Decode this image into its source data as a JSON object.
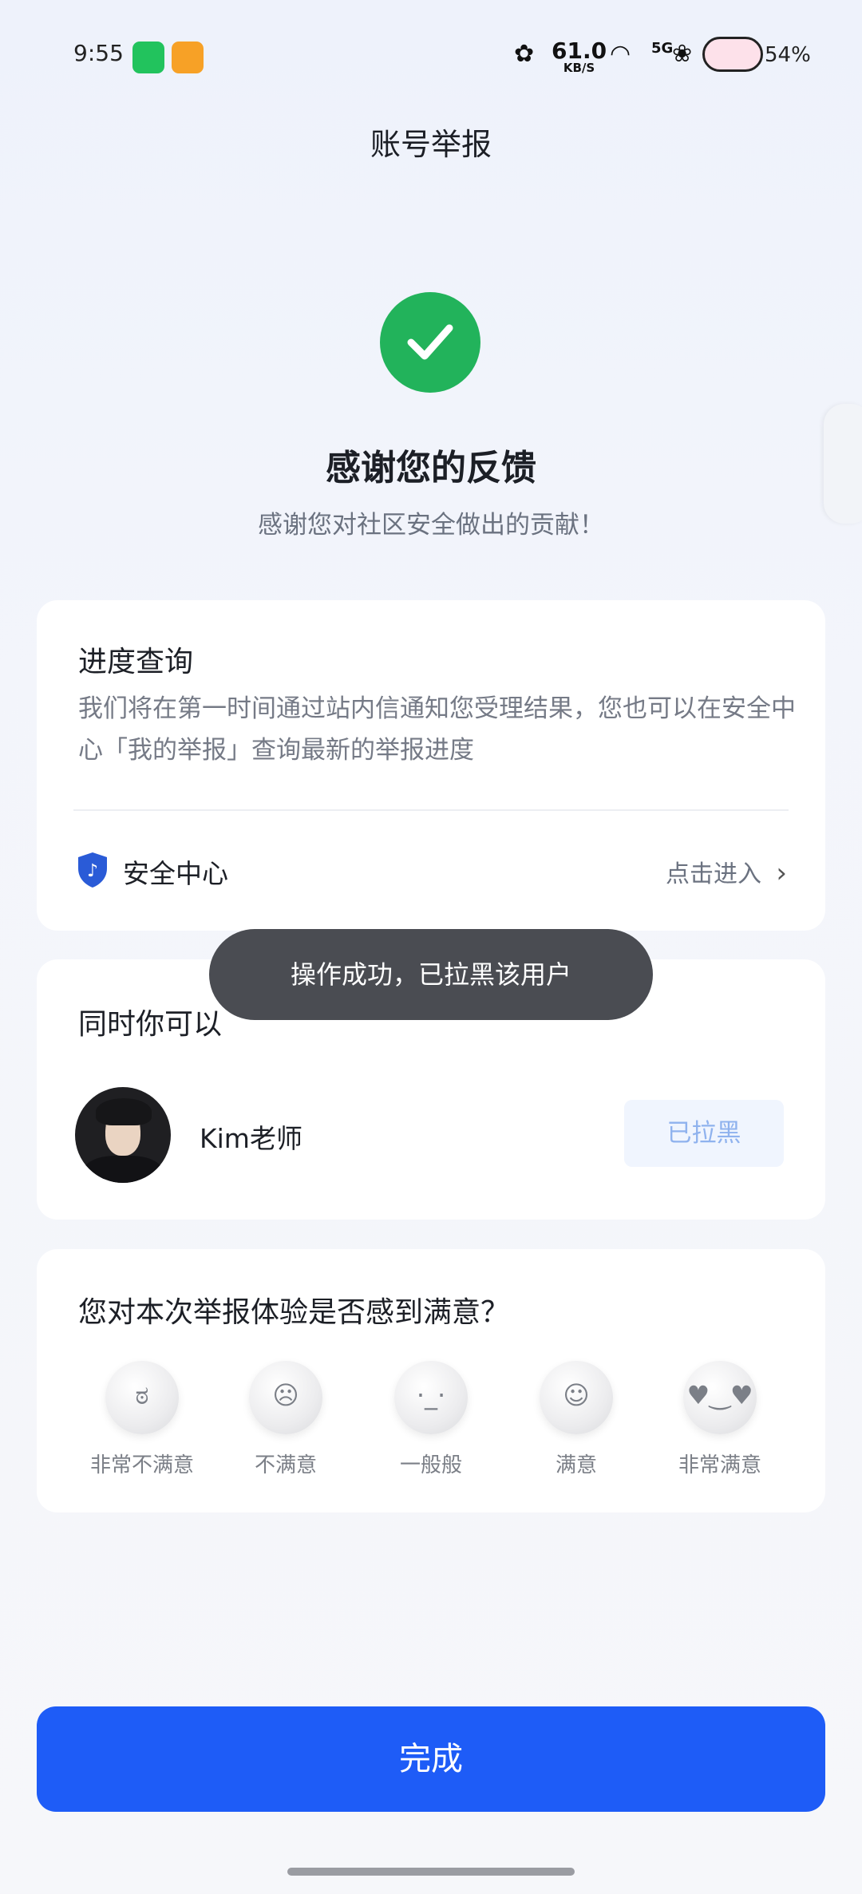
{
  "status_bar": {
    "time": "9:55",
    "speed_value": "61.0",
    "speed_unit": "KB/S",
    "network": "5G",
    "battery": "54%"
  },
  "header": {
    "title": "账号举报"
  },
  "result": {
    "title": "感谢您的反馈",
    "subtitle": "感谢您对社区安全做出的贡献！",
    "icon": "check-circle-icon",
    "color": "#22b35b"
  },
  "progress_card": {
    "title": "进度查询",
    "description": "我们将在第一时间通过站内信通知您受理结果，您也可以在安全中心「我的举报」查询最新的举报进度",
    "security_center_label": "安全中心",
    "enter_label": "点击进入"
  },
  "also_card": {
    "title": "同时你可以",
    "user_name": "Kim老师",
    "blocked_label": "已拉黑"
  },
  "toast": {
    "text": "操作成功，已拉黑该用户"
  },
  "survey": {
    "question": "您对本次举报体验是否感到满意？",
    "options": [
      {
        "label": "非常不满意",
        "icon": "very-dissatisfied-face-icon"
      },
      {
        "label": "不满意",
        "icon": "dissatisfied-face-icon"
      },
      {
        "label": "一般般",
        "icon": "neutral-face-icon"
      },
      {
        "label": "满意",
        "icon": "satisfied-face-icon"
      },
      {
        "label": "非常满意",
        "icon": "very-satisfied-face-icon"
      }
    ]
  },
  "footer": {
    "done_label": "完成",
    "accent": "#1e5cf7"
  }
}
